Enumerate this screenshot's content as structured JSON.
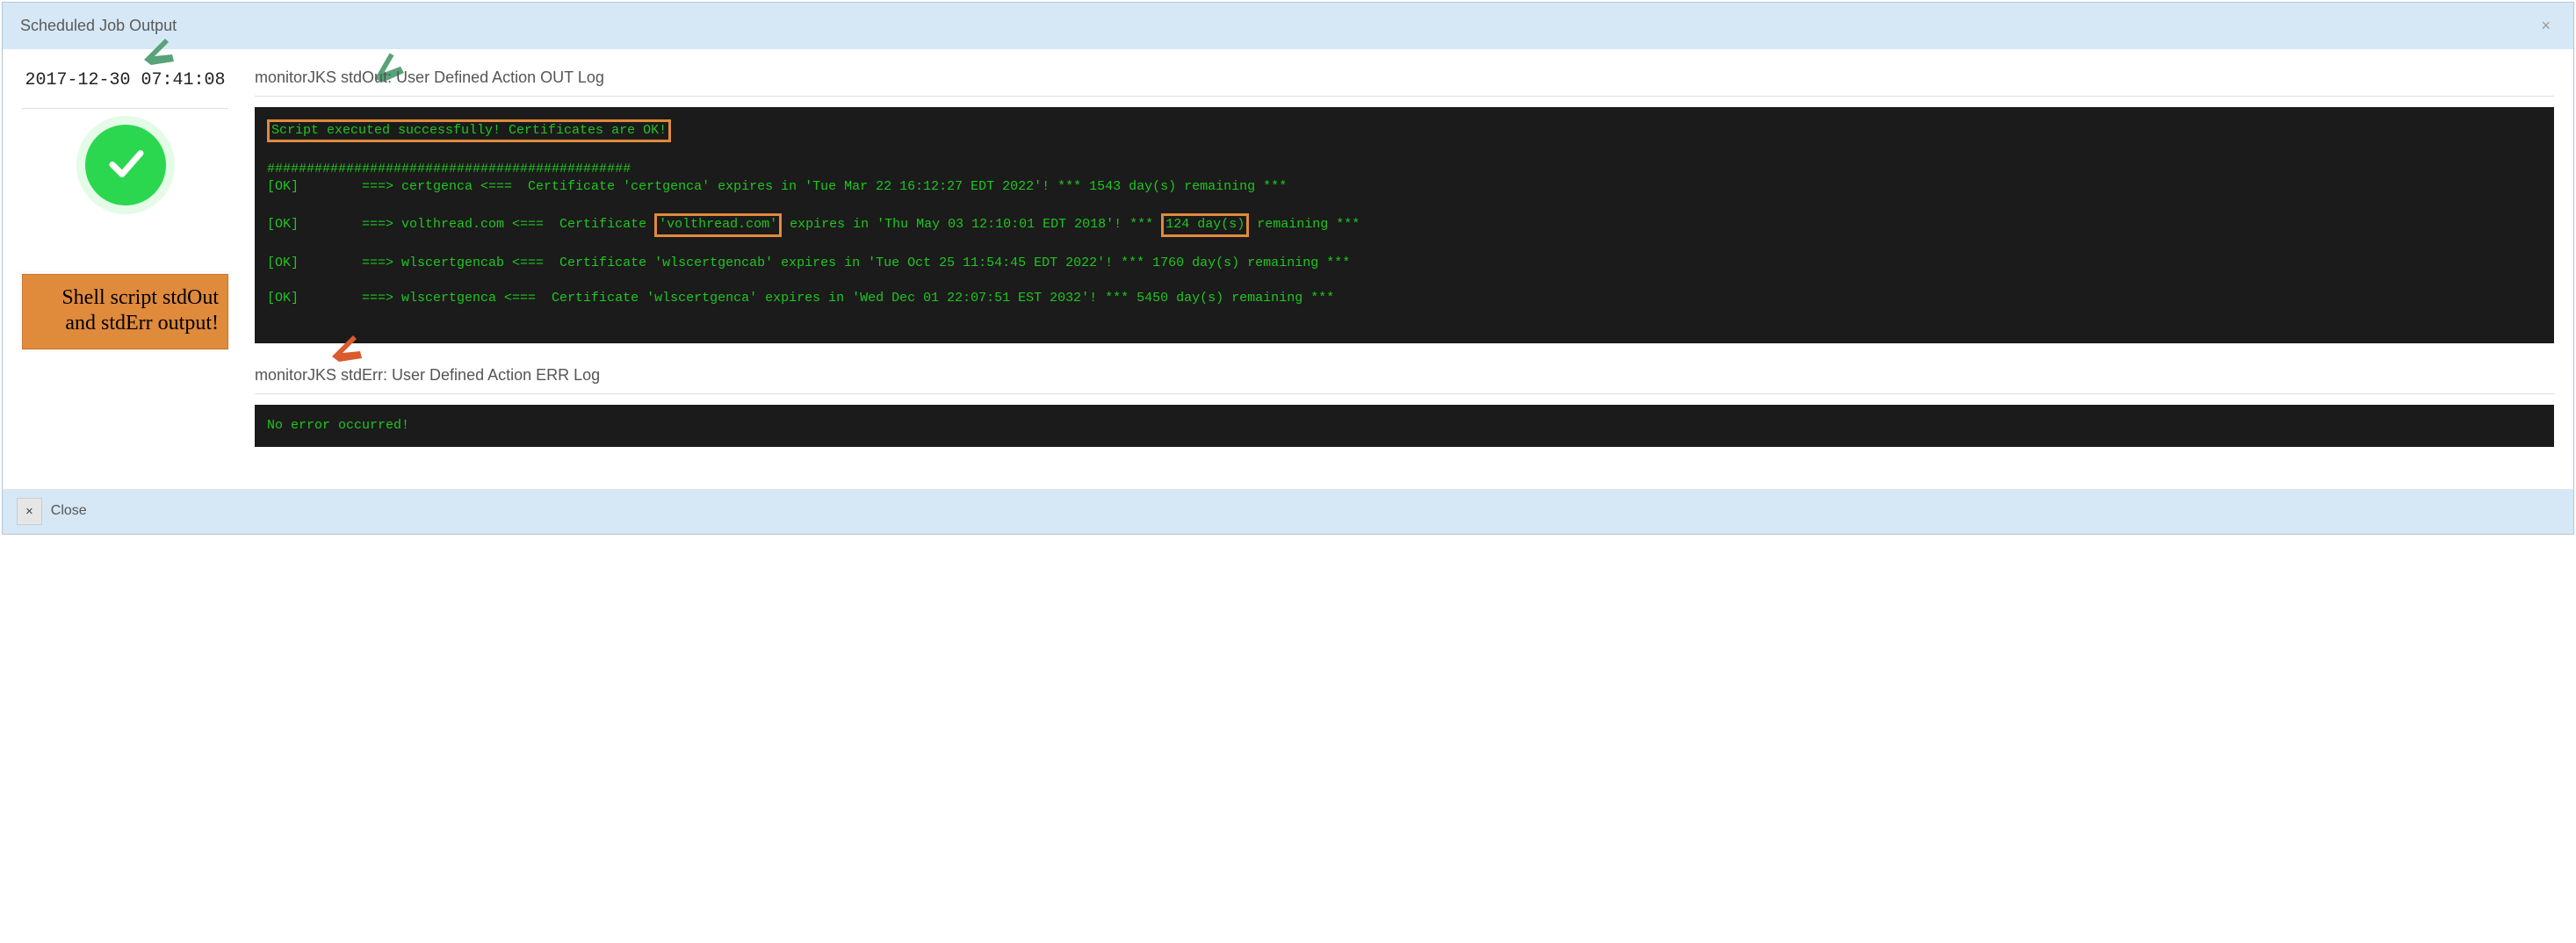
{
  "dialog": {
    "title": "Scheduled Job Output"
  },
  "side": {
    "timestamp": "2017-12-30 07:41:08",
    "annotation": "Shell script stdOut and stdErr output!"
  },
  "stdout": {
    "title": "monitorJKS stdOut: User Defined Action OUT Log",
    "banner": "Script executed successfully! Certificates are OK!",
    "hashline": "##############################################",
    "row1": "[OK]        ===> certgenca <===  Certificate 'certgenca' expires in 'Tue Mar 22 16:12:27 EDT 2022'! *** 1543 day(s) remaining ***",
    "row2a": "[OK]        ===> volthread.com <===  Certificate ",
    "row2_cert": "'volthread.com'",
    "row2b": " expires in 'Thu May 03 12:10:01 EDT 2018'! *** ",
    "row2_days": "124 day(s)",
    "row2c": " remaining ***",
    "row3": "[OK]        ===> wlscertgencab <===  Certificate 'wlscertgencab' expires in 'Tue Oct 25 11:54:45 EDT 2022'! *** 1760 day(s) remaining ***",
    "row4": "[OK]        ===> wlscertgenca <===  Certificate 'wlscertgenca' expires in 'Wed Dec 01 22:07:51 EST 2032'! *** 5450 day(s) remaining ***"
  },
  "stderr": {
    "title": "monitorJKS stdErr: User Defined Action ERR Log",
    "content": "No error occurred!"
  },
  "footer": {
    "x": "×",
    "close": "Close"
  }
}
